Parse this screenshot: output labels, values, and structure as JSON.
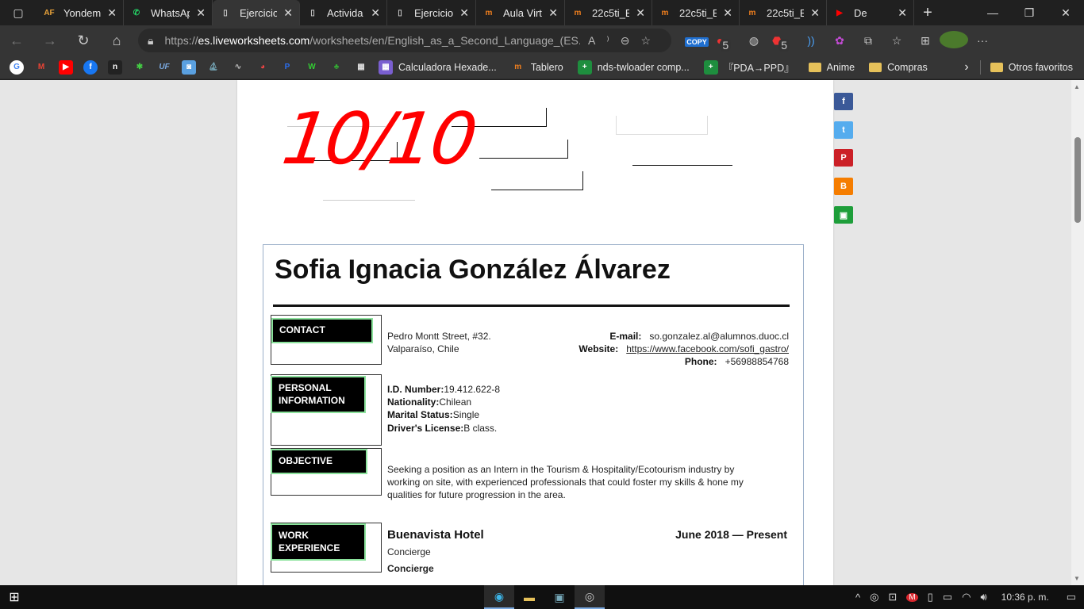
{
  "tabs": [
    {
      "label": "Yondem",
      "icon": "af-icon",
      "icon_text": "AF",
      "icon_color": "#e8a23a"
    },
    {
      "label": "WhatsAp",
      "icon": "whatsapp-icon",
      "icon_text": "✆",
      "icon_color": "#25d366"
    },
    {
      "label": "Ejercicio",
      "icon": "page-icon",
      "icon_text": "▯",
      "icon_color": "#ccc",
      "active": true
    },
    {
      "label": "Activida",
      "icon": "page-icon",
      "icon_text": "▯",
      "icon_color": "#ccc"
    },
    {
      "label": "Ejercicio",
      "icon": "page-icon",
      "icon_text": "▯",
      "icon_color": "#ccc"
    },
    {
      "label": "Aula Virt",
      "icon": "moodle-icon",
      "icon_text": "m",
      "icon_color": "#f07f1e"
    },
    {
      "label": "22c5ti_E",
      "icon": "moodle-icon",
      "icon_text": "m",
      "icon_color": "#f07f1e"
    },
    {
      "label": "22c5ti_E",
      "icon": "moodle-icon",
      "icon_text": "m",
      "icon_color": "#f07f1e"
    },
    {
      "label": "22c5ti_E",
      "icon": "moodle-icon",
      "icon_text": "m",
      "icon_color": "#f07f1e"
    },
    {
      "label": "De",
      "icon": "youtube-icon",
      "icon_text": "▶",
      "icon_color": "#ff0000"
    }
  ],
  "address": {
    "scheme": "https://",
    "host": "es.liveworksheets.com",
    "path": "/worksheets/en/English_as_a_Second_Language_(ES..."
  },
  "extensions": {
    "copy_label": "COPY",
    "badge_a": "5",
    "badge_b": "5"
  },
  "bookmarks": [
    {
      "label": "Calculadora Hexade...",
      "icon": "calculator-icon"
    },
    {
      "label": "Tablero",
      "icon": "moodle-icon"
    },
    {
      "label": "nds-twloader comp...",
      "icon": "plus-icon"
    },
    {
      "label": "『PDA→PPD』",
      "icon": "plus-icon"
    },
    {
      "label": "Anime",
      "icon": "folder-icon"
    },
    {
      "label": "Compras",
      "icon": "folder-icon"
    }
  ],
  "other_bookmarks": "Otros favoritos",
  "worksheet": {
    "score": "10/10"
  },
  "cv": {
    "name": "Sofia Ignacia González Álvarez",
    "sections": {
      "contact": "CONTACT",
      "personal_1": "PERSONAL",
      "personal_2": "INFORMATION",
      "objective": "OBJECTIVE",
      "work_1": "WORK",
      "work_2": "EXPERIENCE"
    },
    "address_line1": "Pedro Montt Street, #32.",
    "address_line2": "Valparaíso, Chile",
    "email_label": "E-mail:",
    "email": "so.gonzalez.al@alumnos.duoc.cl",
    "website_label": "Website:",
    "website": "https://www.facebook.com/sofi_gastro/",
    "phone_label": "Phone:",
    "phone": "+56988854768",
    "id_label": "I.D. Number:",
    "id_value": "19.412.622-8",
    "nationality_label": "Nationality:",
    "nationality_value": "Chilean",
    "marital_label": "Marital Status:",
    "marital_value": "Single",
    "license_label": "Driver's License:",
    "license_value": "B class.",
    "objective_1": "Seeking a position as an Intern in the Tourism & Hospitality/Ecotourism industry by",
    "objective_2": "working on site, with experienced professionals that could foster my skills & hone my",
    "objective_3": "qualities for future progression in the area.",
    "job_company": "Buenavista Hotel",
    "job_dates": "June 2018 — Present",
    "job_role": "Concierge",
    "job_role_bold": "Concierge"
  },
  "social": [
    {
      "name": "facebook-icon",
      "glyph": "f",
      "color": "#3b5998"
    },
    {
      "name": "twitter-icon",
      "glyph": "t",
      "color": "#55acee"
    },
    {
      "name": "pinterest-icon",
      "glyph": "P",
      "color": "#cb2027"
    },
    {
      "name": "blogger-icon",
      "glyph": "B",
      "color": "#f57d00"
    },
    {
      "name": "classroom-icon",
      "glyph": "▣",
      "color": "#1e9e3a"
    }
  ],
  "taskbar": {
    "clock": "10:36 p. m."
  }
}
